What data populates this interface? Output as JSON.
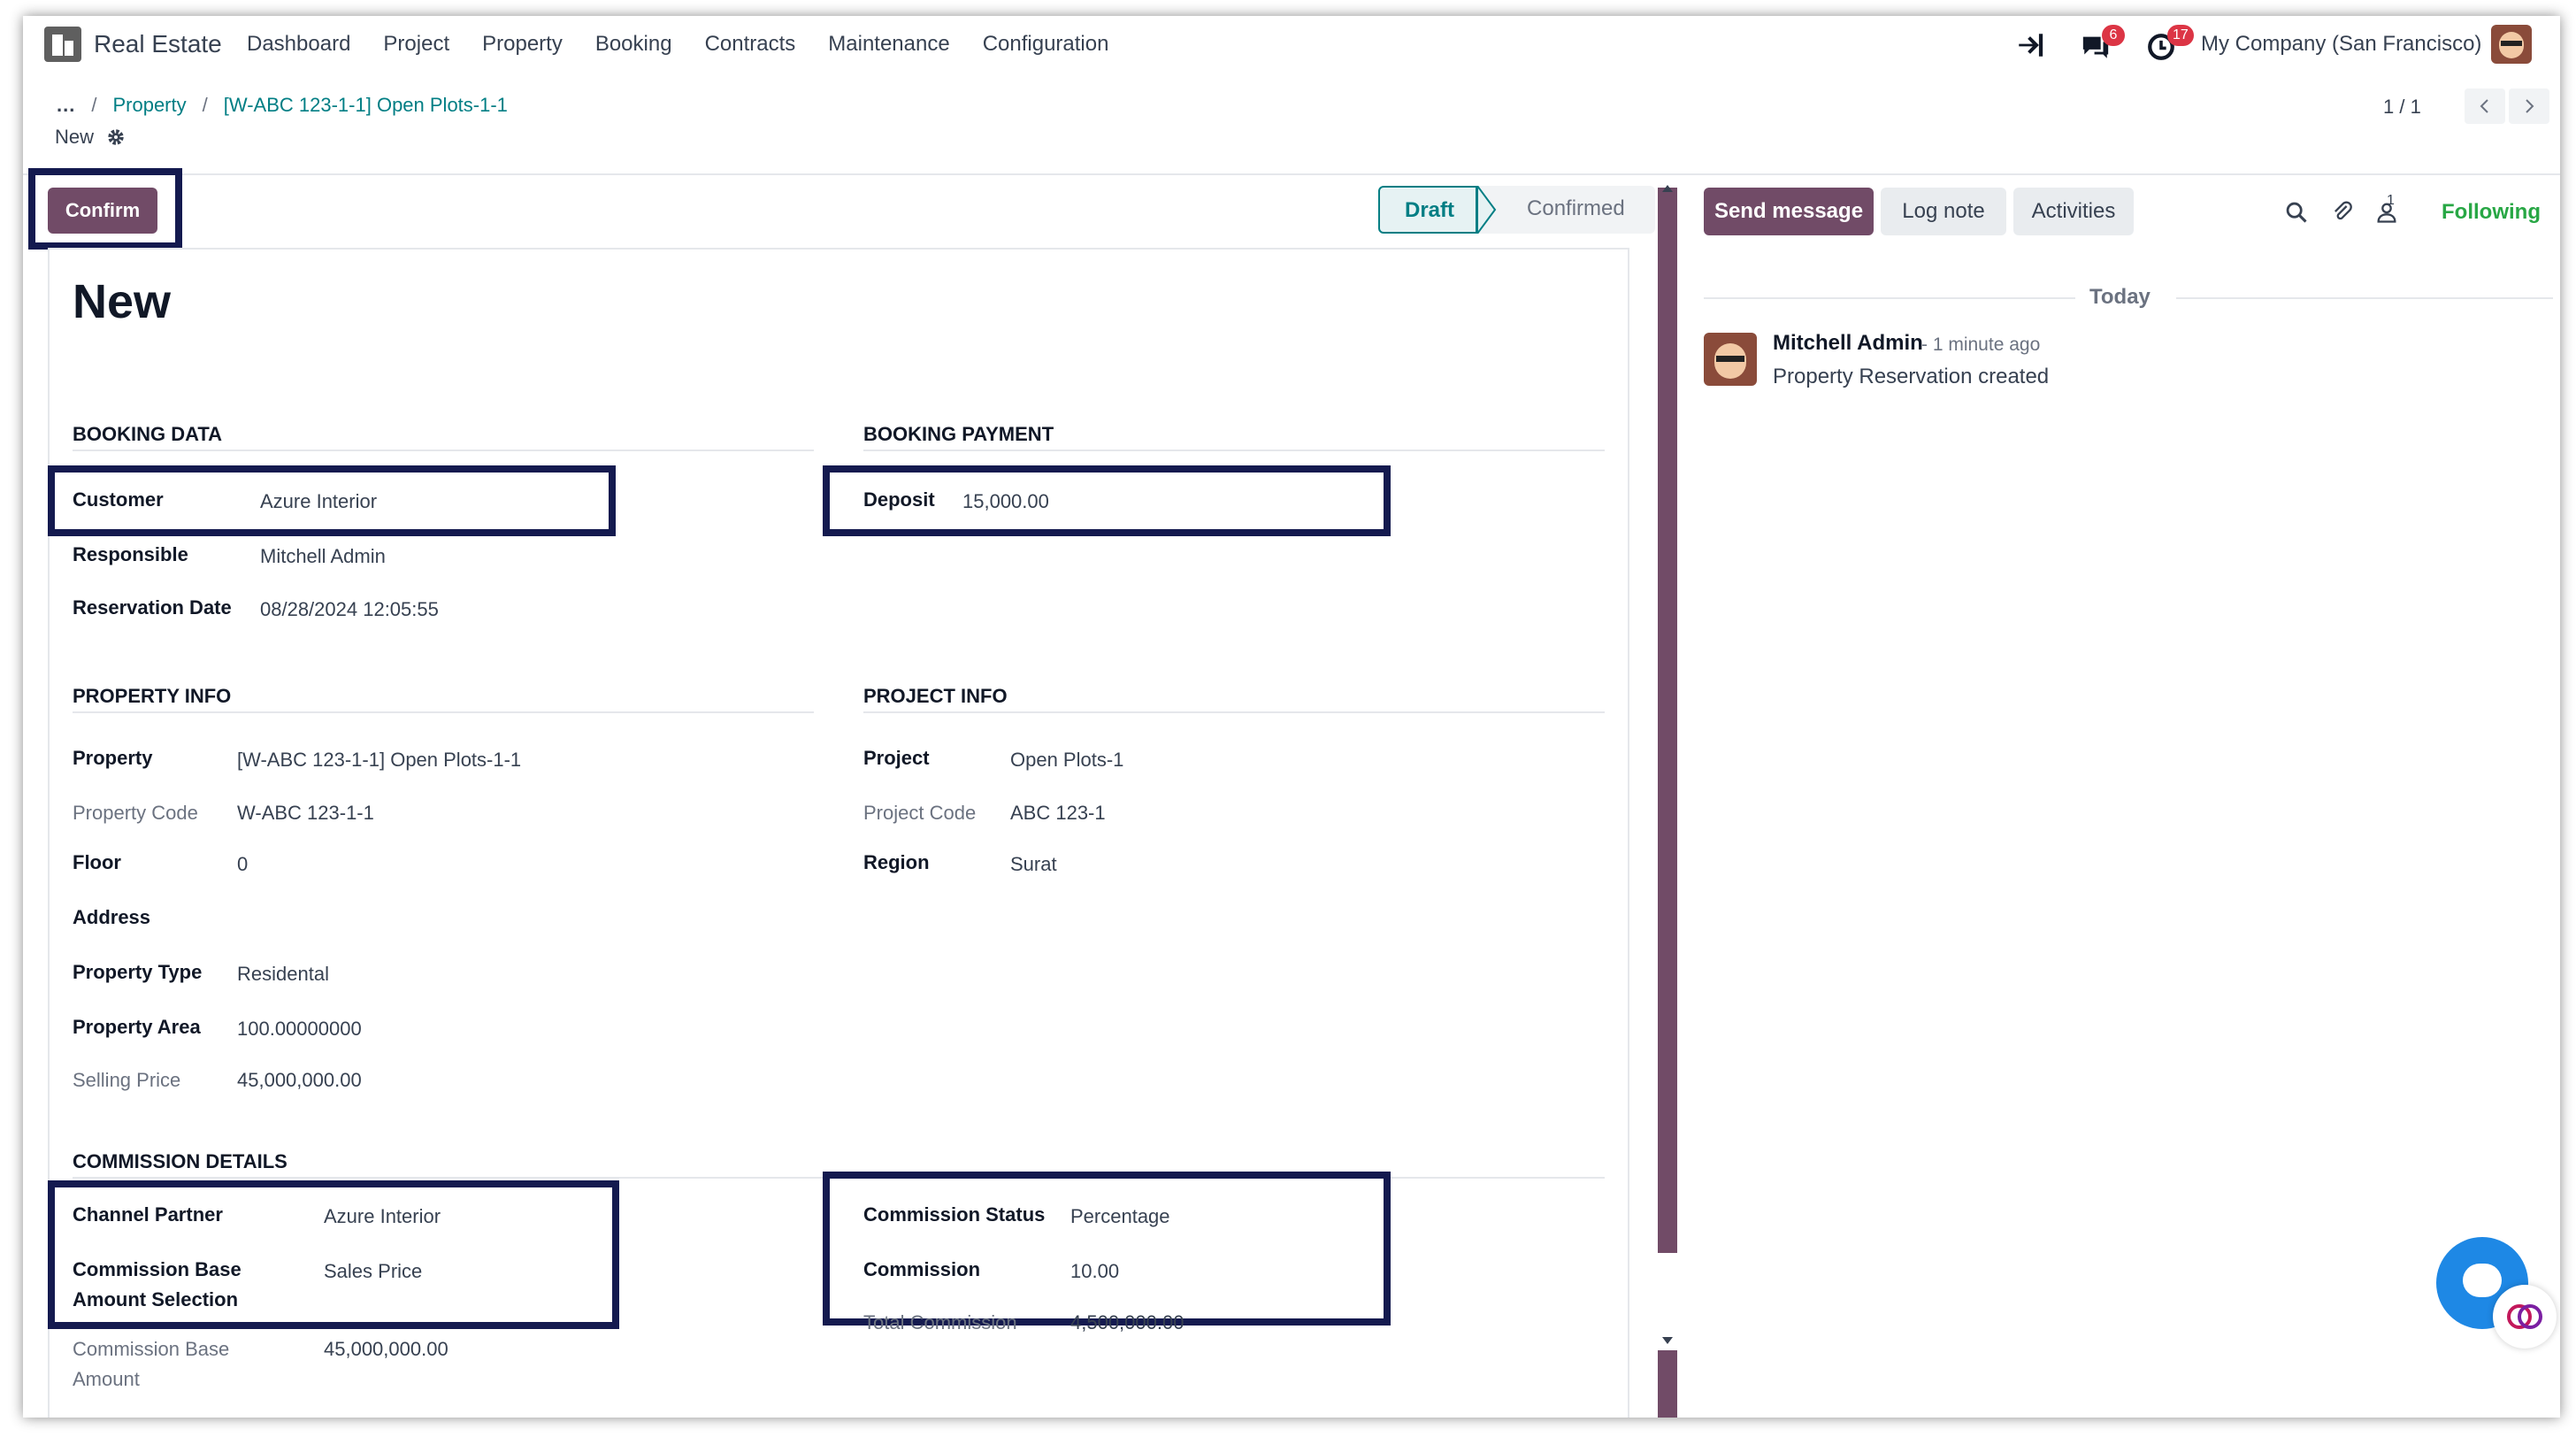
{
  "navbar": {
    "app_name": "Real Estate",
    "menu": [
      "Dashboard",
      "Project",
      "Property",
      "Booking",
      "Contracts",
      "Maintenance",
      "Configuration"
    ],
    "messages_badge": "6",
    "activities_badge": "17",
    "company": "My Company (San Francisco)"
  },
  "breadcrumb": {
    "ellipsis": "...",
    "sep": "/",
    "items": [
      "Property",
      "[W-ABC 123-1-1] Open Plots-1-1"
    ],
    "current": "New"
  },
  "pager": {
    "value": "1 / 1"
  },
  "form": {
    "confirm_label": "Confirm",
    "stages": [
      "Draft",
      "Confirmed"
    ],
    "active_stage": "Draft",
    "title": "New",
    "booking_data": {
      "heading": "BOOKING DATA",
      "customer_label": "Customer",
      "customer": "Azure Interior",
      "responsible_label": "Responsible",
      "responsible": "Mitchell Admin",
      "date_label": "Reservation Date",
      "date": "08/28/2024 12:05:55"
    },
    "booking_payment": {
      "heading": "BOOKING PAYMENT",
      "deposit_label": "Deposit",
      "deposit": "15,000.00"
    },
    "property_info": {
      "heading": "PROPERTY INFO",
      "property_label": "Property",
      "property": "[W-ABC 123-1-1] Open Plots-1-1",
      "code_label": "Property Code",
      "code": "W-ABC 123-1-1",
      "floor_label": "Floor",
      "floor": "0",
      "address_label": "Address",
      "type_label": "Property Type",
      "type": "Residental",
      "area_label": "Property Area",
      "area": "100.00000000",
      "price_label": "Selling Price",
      "price": "45,000,000.00"
    },
    "project_info": {
      "heading": "PROJECT INFO",
      "project_label": "Project",
      "project": "Open Plots-1",
      "code_label": "Project Code",
      "code": "ABC 123-1",
      "region_label": "Region",
      "region": "Surat"
    },
    "commission": {
      "heading": "COMMISSION DETAILS",
      "partner_label": "Channel Partner",
      "partner": "Azure Interior",
      "base_sel_label_1": "Commission Base",
      "base_sel_label_2": "Amount Selection",
      "base_sel": "Sales Price",
      "base_amount_label_1": "Commission Base",
      "base_amount_label_2": "Amount",
      "base_amount": "45,000,000.00",
      "status_label": "Commission Status",
      "status": "Percentage",
      "commission_label": "Commission",
      "commission": "10.00",
      "total_label": "Total Commission",
      "total": "4,500,000.00"
    }
  },
  "chatter": {
    "send_label": "Send message",
    "log_label": "Log note",
    "activities_label": "Activities",
    "followers_count": "1",
    "following_label": "Following",
    "day": "Today",
    "message": {
      "author": "Mitchell Admin",
      "time": "- 1 minute ago",
      "body": "Property Reservation created"
    }
  },
  "colors": {
    "primary": "#714b67",
    "link": "#017e84",
    "highlight": "#141a4f",
    "following": "#28a745"
  }
}
